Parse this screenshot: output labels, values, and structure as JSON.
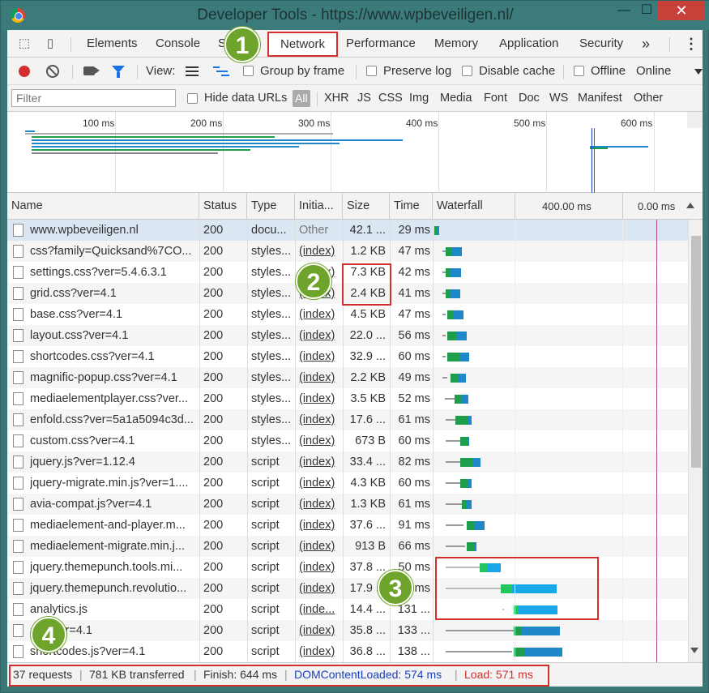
{
  "window": {
    "title": "Developer Tools - https://www.wpbeveiligen.nl/",
    "minimize_glyph": "—",
    "maximize_glyph": "☐",
    "close_glyph": "✕"
  },
  "tabs": {
    "more_glyph": "»",
    "menu_glyph": "⋮",
    "items": [
      "Elements",
      "Console",
      "So",
      "Network",
      "Performance",
      "Memory",
      "Application",
      "Security"
    ],
    "active": "Network"
  },
  "toolbar": {
    "view_label": "View:",
    "group_by_frame": "Group by frame",
    "preserve_log": "Preserve log",
    "disable_cache": "Disable cache",
    "offline": "Offline",
    "online": "Online"
  },
  "filterbar": {
    "placeholder": "Filter",
    "hide_data_urls": "Hide data URLs",
    "types": [
      "All",
      "XHR",
      "JS",
      "CSS",
      "Img",
      "Media",
      "Font",
      "Doc",
      "WS",
      "Manifest",
      "Other"
    ]
  },
  "overview": {
    "ticks": [
      "100 ms",
      "200 ms",
      "300 ms",
      "400 ms",
      "500 ms",
      "600 ms"
    ]
  },
  "table": {
    "headers": {
      "name": "Name",
      "status": "Status",
      "type": "Type",
      "initiator": "Initia...",
      "size": "Size",
      "time": "Time",
      "waterfall": "Waterfall",
      "wf_tick1": "400.00 ms",
      "wf_tick2": "0.00 ms"
    },
    "rows": [
      {
        "name": "www.wpbeveiligen.nl",
        "status": "200",
        "type": "docu...",
        "initiator": "Other",
        "size": "42.1 ...",
        "time": "29 ms"
      },
      {
        "name": "css?family=Quicksand%7CO...",
        "status": "200",
        "type": "styles...",
        "initiator": "(index)",
        "size": "1.2 KB",
        "time": "47 ms"
      },
      {
        "name": "settings.css?ver=5.4.6.3.1",
        "status": "200",
        "type": "styles...",
        "initiator": "(index)",
        "size": "7.3 KB",
        "time": "42 ms"
      },
      {
        "name": "grid.css?ver=4.1",
        "status": "200",
        "type": "styles...",
        "initiator": "(index)",
        "size": "2.4 KB",
        "time": "41 ms"
      },
      {
        "name": "base.css?ver=4.1",
        "status": "200",
        "type": "styles...",
        "initiator": "(index)",
        "size": "4.5 KB",
        "time": "47 ms"
      },
      {
        "name": "layout.css?ver=4.1",
        "status": "200",
        "type": "styles...",
        "initiator": "(index)",
        "size": "22.0 ...",
        "time": "56 ms"
      },
      {
        "name": "shortcodes.css?ver=4.1",
        "status": "200",
        "type": "styles...",
        "initiator": "(index)",
        "size": "32.9 ...",
        "time": "60 ms"
      },
      {
        "name": "magnific-popup.css?ver=4.1",
        "status": "200",
        "type": "styles...",
        "initiator": "(index)",
        "size": "2.2 KB",
        "time": "49 ms"
      },
      {
        "name": "mediaelementplayer.css?ver...",
        "status": "200",
        "type": "styles...",
        "initiator": "(index)",
        "size": "3.5 KB",
        "time": "52 ms"
      },
      {
        "name": "enfold.css?ver=5a1a5094c3d...",
        "status": "200",
        "type": "styles...",
        "initiator": "(index)",
        "size": "17.6 ...",
        "time": "61 ms"
      },
      {
        "name": "custom.css?ver=4.1",
        "status": "200",
        "type": "styles...",
        "initiator": "(index)",
        "size": "673 B",
        "time": "60 ms"
      },
      {
        "name": "jquery.js?ver=1.12.4",
        "status": "200",
        "type": "script",
        "initiator": "(index)",
        "size": "33.4 ...",
        "time": "82 ms"
      },
      {
        "name": "jquery-migrate.min.js?ver=1....",
        "status": "200",
        "type": "script",
        "initiator": "(index)",
        "size": "4.3 KB",
        "time": "60 ms"
      },
      {
        "name": "avia-compat.js?ver=4.1",
        "status": "200",
        "type": "script",
        "initiator": "(index)",
        "size": "1.3 KB",
        "time": "61 ms"
      },
      {
        "name": "mediaelement-and-player.m...",
        "status": "200",
        "type": "script",
        "initiator": "(index)",
        "size": "37.6 ...",
        "time": "91 ms"
      },
      {
        "name": "mediaelement-migrate.min.j...",
        "status": "200",
        "type": "script",
        "initiator": "(index)",
        "size": "913 B",
        "time": "66 ms"
      },
      {
        "name": "jquery.themepunch.tools.mi...",
        "status": "200",
        "type": "script",
        "initiator": "(index)",
        "size": "37.8 ...",
        "time": "50 ms"
      },
      {
        "name": "jquery.themepunch.revolutio...",
        "status": "200",
        "type": "script",
        "initiator": "(index)",
        "size": "17.9 ...",
        "time": "...ms"
      },
      {
        "name": "analytics.js",
        "status": "200",
        "type": "script",
        "initiator": "(inde...",
        "size": "14.4 ...",
        "time": "131 ..."
      },
      {
        "name": "a...?ver=4.1",
        "status": "200",
        "type": "script",
        "initiator": "(index)",
        "size": "35.8 ...",
        "time": "133 ..."
      },
      {
        "name": "shortcodes.js?ver=4.1",
        "status": "200",
        "type": "script",
        "initiator": "(index)",
        "size": "36.8 ...",
        "time": "138 ..."
      }
    ]
  },
  "statusbar": {
    "requests": "37 requests",
    "transferred": "781 KB transferred",
    "finish": "Finish: 644 ms",
    "dcl": "DOMContentLoaded: 574 ms",
    "load": "Load: 571 ms",
    "sep": "|"
  },
  "annotations": [
    "1",
    "2",
    "3",
    "4"
  ],
  "colors": {
    "accent_red": "#d32f2f",
    "badge_green": "#6fa42c",
    "waterfall_green": "#1e9e4a",
    "waterfall_blue": "#1e88c8"
  }
}
